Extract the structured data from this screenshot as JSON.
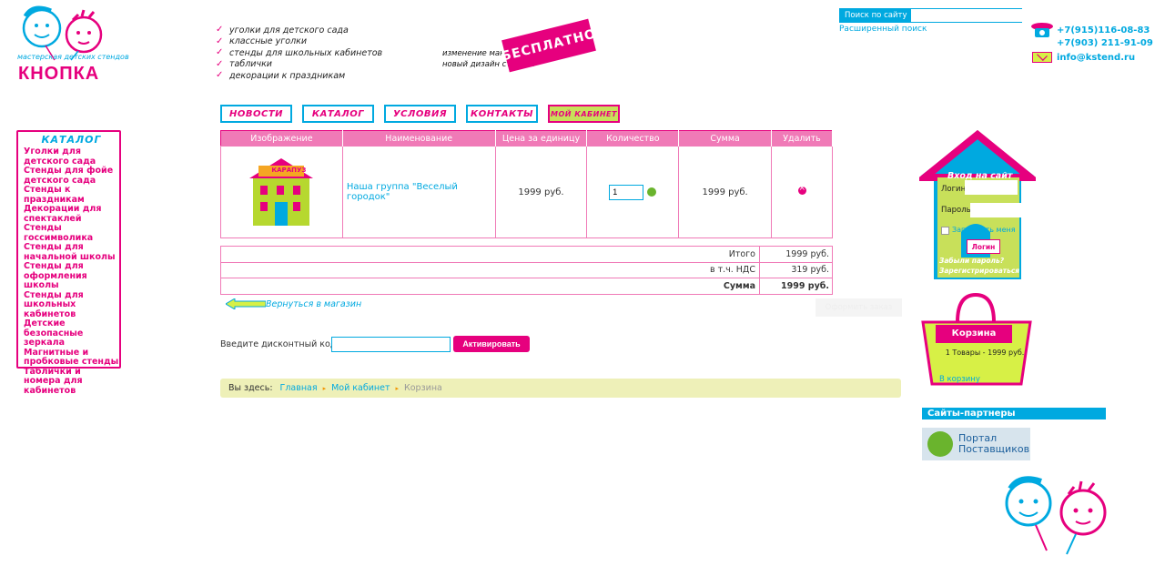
{
  "logo": {
    "brand": "КНОПКА",
    "tagline": "мастерская детских стендов"
  },
  "features": [
    "уголки для детского сада",
    "классные уголки",
    "стенды для школьных кабинетов",
    "таблички",
    "декорации к праздникам"
  ],
  "promo": {
    "line1": "изменение макета",
    "line2": "новый дизайн стендов",
    "stamp": "БЕСПЛАТНО"
  },
  "search": {
    "label": "Поиск по сайту",
    "placeholder": "",
    "advanced": "Расширенный поиск"
  },
  "contacts": {
    "phone1": "+7(915)116-08-83",
    "phone2": "+7(903) 211-91-09",
    "email": "info@kstend.ru"
  },
  "nav": [
    {
      "label": "НОВОСТИ"
    },
    {
      "label": "КАТАЛОГ"
    },
    {
      "label": "УСЛОВИЯ"
    },
    {
      "label": "КОНТАКТЫ"
    },
    {
      "label": "МОЙ КАБИНЕТ"
    }
  ],
  "catalog": {
    "title": "КАТАЛОГ",
    "items": [
      "Уголки для детского сада",
      "Стенды для фойе детского сада",
      "Стенды к праздникам",
      "Декорации для спектаклей",
      "Стенды госсимволика",
      "Стенды для начальной школы",
      "Стенды для оформления школы",
      "Стенды для школьных кабинетов",
      "Детские безопасные зеркала",
      "Магнитные и пробковые стенды",
      "Таблички и номера для кабинетов"
    ]
  },
  "cart": {
    "headers": [
      "Изображение",
      "Наименование",
      "Цена за единицу",
      "Количество",
      "Сумма",
      "Удалить"
    ],
    "rows": [
      {
        "name": "Наша группа \"Веселый городок\"",
        "price": "1999 руб.",
        "qty": "1",
        "sum": "1999 руб.",
        "thumb_label": "КАРАПУЗ"
      }
    ]
  },
  "totals": [
    {
      "label": "Итого",
      "value": "1999 руб."
    },
    {
      "label": "в т.ч. НДС",
      "value": "319 руб."
    },
    {
      "label": "Сумма",
      "value": "1999 руб."
    }
  ],
  "back_link": "Вернуться в магазин",
  "checkout": "Оформить заказ",
  "coupon": {
    "label": "Введите дисконтный код",
    "value": "",
    "button": "Активировать"
  },
  "breadcrumb": {
    "prefix": "Вы здесь:",
    "items": [
      "Главная",
      "Мой кабинет"
    ],
    "current": "Корзина"
  },
  "login": {
    "title": "Вход на сайт",
    "login_label": "Логин",
    "password_label": "Пароль",
    "remember": "Запомнить меня",
    "button": "Логин",
    "forgot": "Забыли пароль?",
    "register": "Зарегистрироваться"
  },
  "basket": {
    "title": "Корзина",
    "info": "1 Товары - 1999 руб.",
    "link": "В корзину"
  },
  "partners": {
    "title": "Сайты-партнеры",
    "partner_name_line1": "Портал",
    "partner_name_line2": "Поставщиков"
  },
  "colors": {
    "accent_pink": "#e6007e",
    "accent_blue": "#00a9e0",
    "accent_green": "#c8e05a"
  }
}
